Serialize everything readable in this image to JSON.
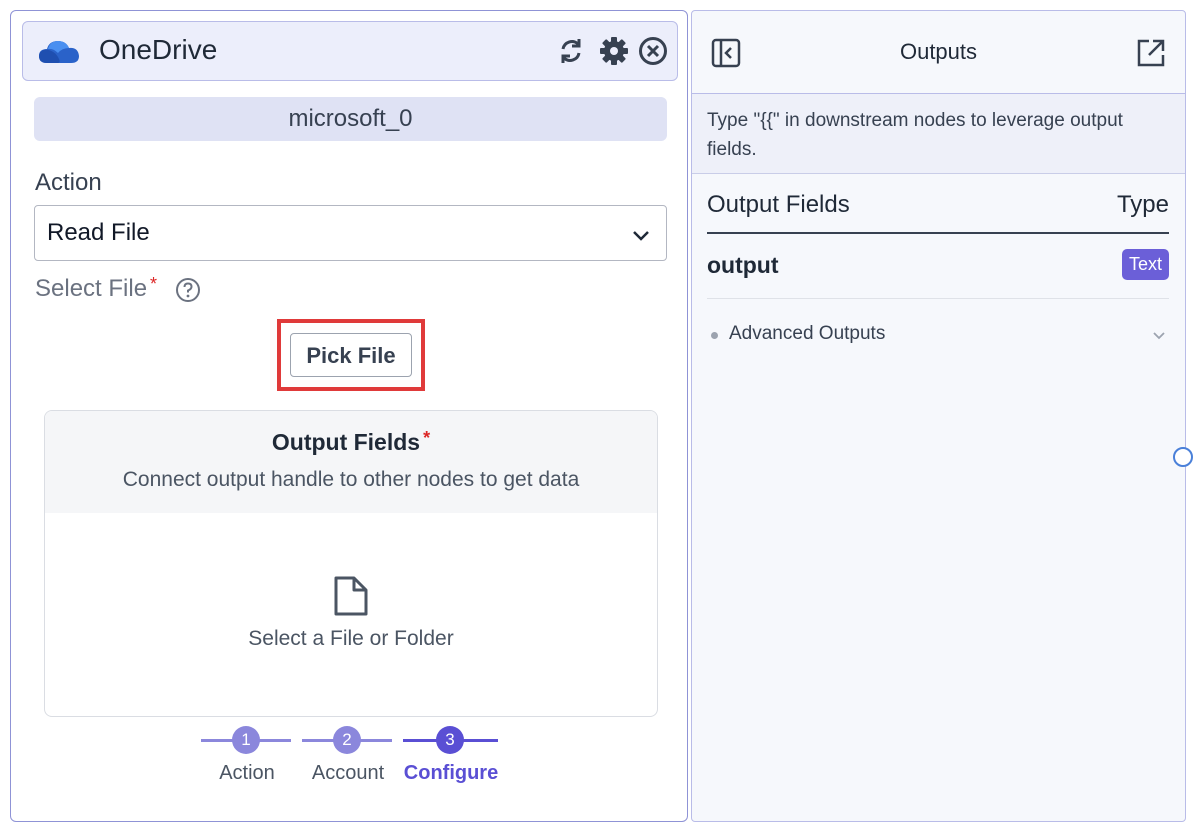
{
  "node": {
    "title": "OneDrive",
    "icons": [
      "sync-icon",
      "gear-icon",
      "close-circle-icon"
    ],
    "account": "microsoft_0",
    "action_label": "Action",
    "action_value": "Read File",
    "select_file_label": "Select File",
    "required_mark": "*",
    "pick_file_button": "Pick File",
    "output_card": {
      "title": "Output Fields",
      "subtitle": "Connect output handle to other nodes to get data",
      "empty_text": "Select a File or Folder"
    },
    "stepper": {
      "steps": [
        {
          "number": "1",
          "label": "Action"
        },
        {
          "number": "2",
          "label": "Account"
        },
        {
          "number": "3",
          "label": "Configure"
        }
      ],
      "active_step": 3
    }
  },
  "outputs": {
    "title": "Outputs",
    "description": "Type \"{{\" in downstream nodes to leverage output fields.",
    "columns": {
      "left": "Output Fields",
      "right": "Type"
    },
    "rows": [
      {
        "name": "output",
        "type": "Text"
      }
    ],
    "advanced_label": "Advanced Outputs"
  },
  "colors": {
    "accent": "#6b5fd8",
    "node_border": "#8f93d6",
    "highlight": "#e03a3a",
    "step_inactive": "#8b87dc",
    "step_active": "#5a4fd4"
  }
}
